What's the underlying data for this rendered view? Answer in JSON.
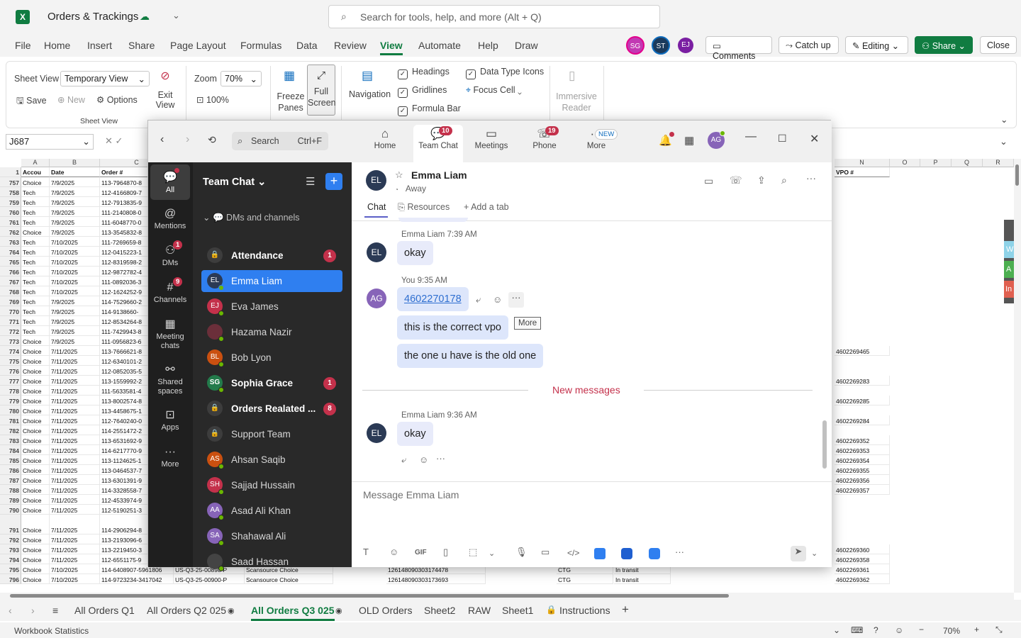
{
  "excel": {
    "title": "Orders & Trackings",
    "search_placeholder": "Search for tools, help, and more (Alt + Q)",
    "menu": [
      "File",
      "Home",
      "Insert",
      "Share",
      "Page Layout",
      "Formulas",
      "Data",
      "Review",
      "View",
      "Automate",
      "Help",
      "Draw"
    ],
    "avatars": [
      "SG",
      "ST",
      "EJ"
    ],
    "header_buttons": {
      "comments": "Comments",
      "catchup": "Catch up",
      "editing": "Editing",
      "share": "Share",
      "close": "Close"
    },
    "ribbon": {
      "sheet_view_label": "Sheet View",
      "sheet_view_value": "Temporary View",
      "save": "Save",
      "new": "New",
      "options": "Options",
      "exit_view": "Exit View",
      "group_label": "Sheet View",
      "zoom_label": "Zoom",
      "zoom_value": "70%",
      "zoom_100": "100%",
      "freeze": "Freeze Panes",
      "full_screen": "Full Screen",
      "navigation": "Navigation",
      "headings": "Headings",
      "gridlines": "Gridlines",
      "formula_bar": "Formula Bar",
      "data_type_icons": "Data Type Icons",
      "focus_cell": "Focus Cell",
      "immersive": "Immersive Reader"
    },
    "name_box": "J687",
    "fx": "fx",
    "col_headers": {
      "A": "A",
      "B": "B",
      "C": "C",
      "N": "N",
      "O": "O",
      "P": "P",
      "Q": "Q",
      "R": "R"
    },
    "header_row": {
      "num": "1",
      "A": "Accou",
      "B": "Date",
      "C": "Order #",
      "N": "VPO #"
    },
    "rows": [
      {
        "n": "757",
        "a": "Choice",
        "b": "7/9/2025",
        "c": "113-7964870-8"
      },
      {
        "n": "758",
        "a": "Tech",
        "b": "7/9/2025",
        "c": "112-4166809-7"
      },
      {
        "n": "759",
        "a": "Tech",
        "b": "7/9/2025",
        "c": "112-7913835-9"
      },
      {
        "n": "760",
        "a": "Tech",
        "b": "7/9/2025",
        "c": "111-2140808-0"
      },
      {
        "n": "761",
        "a": "Tech",
        "b": "7/9/2025",
        "c": "111-6048770-0"
      },
      {
        "n": "762",
        "a": "Choice",
        "b": "7/9/2025",
        "c": "113-3545832-8"
      },
      {
        "n": "763",
        "a": "Tech",
        "b": "7/10/2025",
        "c": "111-7269659-8"
      },
      {
        "n": "764",
        "a": "Tech",
        "b": "7/10/2025",
        "c": "112-0415223-1"
      },
      {
        "n": "765",
        "a": "Tech",
        "b": "7/10/2025",
        "c": "112-8319598-2"
      },
      {
        "n": "766",
        "a": "Tech",
        "b": "7/10/2025",
        "c": "112-9872782-4"
      },
      {
        "n": "767",
        "a": "Tech",
        "b": "7/10/2025",
        "c": "111-0892036-3"
      },
      {
        "n": "768",
        "a": "Tech",
        "b": "7/10/2025",
        "c": "112-1624252-9"
      },
      {
        "n": "769",
        "a": "Tech",
        "b": "7/9/2025",
        "c": "114-7529660-2"
      },
      {
        "n": "770",
        "a": "Tech",
        "b": "7/9/2025",
        "c": "114-9138660-"
      },
      {
        "n": "771",
        "a": "Tech",
        "b": "7/9/2025",
        "c": "112-8534264-8"
      },
      {
        "n": "772",
        "a": "Tech",
        "b": "7/9/2025",
        "c": "111-7429943-8"
      },
      {
        "n": "773",
        "a": "Choice",
        "b": "7/9/2025",
        "c": "111-0956823-6"
      },
      {
        "n": "774",
        "a": "Choice",
        "b": "7/11/2025",
        "c": "113-7666621-8",
        "vpo": "4602269465"
      },
      {
        "n": "775",
        "a": "Choice",
        "b": "7/11/2025",
        "c": "112-6340101-2"
      },
      {
        "n": "776",
        "a": "Choice",
        "b": "7/11/2025",
        "c": "112-0852035-5"
      },
      {
        "n": "777",
        "a": "Choice",
        "b": "7/11/2025",
        "c": "113-1559992-2",
        "vpo": "4602269283"
      },
      {
        "n": "778",
        "a": "Choice",
        "b": "7/11/2025",
        "c": "111-5633581-4"
      },
      {
        "n": "779",
        "a": "Choice",
        "b": "7/11/2025",
        "c": "113-8002574-8",
        "vpo": "4602269285"
      },
      {
        "n": "780",
        "a": "Choice",
        "b": "7/11/2025",
        "c": "113-4458675-1"
      },
      {
        "n": "781",
        "a": "Choice",
        "b": "7/11/2025",
        "c": "112-7640240-0",
        "vpo": "4602269284"
      },
      {
        "n": "782",
        "a": "Choice",
        "b": "7/11/2025",
        "c": "114-2551472-2"
      },
      {
        "n": "783",
        "a": "Choice",
        "b": "7/11/2025",
        "c": "113-6531692-9",
        "vpo": "4602269352"
      },
      {
        "n": "784",
        "a": "Choice",
        "b": "7/11/2025",
        "c": "114-6217770-9",
        "vpo": "4602269353"
      },
      {
        "n": "785",
        "a": "Choice",
        "b": "7/11/2025",
        "c": "113-1124625-1",
        "vpo": "4602269354"
      },
      {
        "n": "786",
        "a": "Choice",
        "b": "7/11/2025",
        "c": "113-0464537-7",
        "vpo": "4602269355"
      },
      {
        "n": "787",
        "a": "Choice",
        "b": "7/11/2025",
        "c": "113-6301391-9",
        "vpo": "4602269356"
      },
      {
        "n": "788",
        "a": "Choice",
        "b": "7/11/2025",
        "c": "114-3328558-7",
        "vpo": "4602269357"
      },
      {
        "n": "789",
        "a": "Choice",
        "b": "7/11/2025",
        "c": "112-4533974-9"
      },
      {
        "n": "790",
        "a": "Choice",
        "b": "7/11/2025",
        "c": "112-5190251-3"
      },
      {
        "n": "791",
        "a": "Choice",
        "b": "7/11/2025",
        "c": "114-2906294-8"
      },
      {
        "n": "792",
        "a": "Choice",
        "b": "7/11/2025",
        "c": "113-2193096-6"
      },
      {
        "n": "793",
        "a": "Choice",
        "b": "7/11/2025",
        "c": "113-2219450-3",
        "vpo": "4602269360"
      },
      {
        "n": "794",
        "a": "Choice",
        "b": "7/11/2025",
        "c": "112-6551175-9",
        "vpo": "4602269358"
      },
      {
        "n": "795",
        "a": "Choice",
        "b": "7/10/2025",
        "c": "114-6408907-5961806",
        "d": "US-Q3-25-00898-P",
        "e": "Scansource Choice",
        "f": "126148090303174478",
        "g": "CTG",
        "h": "In transit",
        "vpo": "4602269361"
      },
      {
        "n": "796",
        "a": "Choice",
        "b": "7/10/2025",
        "c": "114-9723234-3417042",
        "d": "US-Q3-25-00900-P",
        "e": "Scansource Choice",
        "f": "126148090303173693",
        "g": "CTG",
        "h": "In transit",
        "vpo": "4602269362"
      }
    ],
    "sheet_tabs": [
      "All Orders Q1",
      "All Orders Q2 025",
      "All Orders Q3 025",
      "OLD Orders",
      "Sheet2",
      "RAW",
      "Sheet1",
      "Instructions"
    ],
    "status_left": "Workbook Statistics",
    "status_zoom": "70%",
    "side_tabs": [
      "W",
      "A",
      "In"
    ]
  },
  "teams": {
    "search": "Search",
    "search_shortcut": "Ctrl+F",
    "nav": [
      {
        "label": "Home"
      },
      {
        "label": "Team Chat",
        "badge": "10"
      },
      {
        "label": "Meetings"
      },
      {
        "label": "Phone",
        "badge": "19"
      },
      {
        "label": "More",
        "badge": "NEW"
      }
    ],
    "me": "AG",
    "rail": [
      {
        "label": "All"
      },
      {
        "label": "Mentions"
      },
      {
        "label": "DMs",
        "badge": "1"
      },
      {
        "label": "Channels",
        "badge": "9"
      },
      {
        "label": "Meeting chats"
      },
      {
        "label": "Shared spaces"
      },
      {
        "label": "Apps"
      },
      {
        "label": "More"
      }
    ],
    "list_title": "Team Chat",
    "section": "DMs and channels",
    "chats": [
      {
        "name": "Attendance",
        "bold": true,
        "count": "1",
        "icon": "lock"
      },
      {
        "name": "Emma Liam",
        "initials": "EL",
        "selected": true,
        "color": "#2b3a55"
      },
      {
        "name": "Eva James",
        "initials": "EJ",
        "color": "#c4314b"
      },
      {
        "name": "Hazama Nazir",
        "initials": "",
        "color": "#6b2f3a"
      },
      {
        "name": "Bob Lyon",
        "initials": "BL",
        "color": "#ca5010"
      },
      {
        "name": "Sophia Grace",
        "initials": "SG",
        "bold": true,
        "count": "1",
        "color": "#237b4b"
      },
      {
        "name": "Orders Realated ...",
        "bold": true,
        "count": "8",
        "icon": "lock"
      },
      {
        "name": "Support Team",
        "icon": "lock"
      },
      {
        "name": "Ahsan Saqib",
        "initials": "AS",
        "color": "#ca5010"
      },
      {
        "name": "Sajjad Hussain",
        "initials": "SH",
        "color": "#c4314b"
      },
      {
        "name": "Asad Ali Khan",
        "initials": "AA",
        "color": "#8764b8"
      },
      {
        "name": "Shahawal Ali",
        "initials": "SA",
        "color": "#8764b8"
      },
      {
        "name": "Saad Hassan",
        "initials": "",
        "color": "#444"
      }
    ],
    "contact": {
      "name": "Emma Liam",
      "initials": "EL",
      "status": "Away"
    },
    "tabs": {
      "chat": "Chat",
      "resources": "Resources",
      "add": "Add a tab"
    },
    "messages": {
      "m1_meta": "Emma Liam 7:39 AM",
      "m1_text": "okay",
      "m2_meta": "You 9:35 AM",
      "m2_link": "4602270178",
      "m2_text2": "this is the correct vpo",
      "m2_text3": "the one u have is the old one",
      "tooltip": "More",
      "divider": "New messages",
      "m3_meta": "Emma Liam 9:36 AM",
      "m3_text": "okay"
    },
    "composer_placeholder": "Message Emma Liam",
    "colors": {
      "accent": "#5b5fc7",
      "selected": "#2f7ff0",
      "badge": "#c4314b"
    }
  }
}
